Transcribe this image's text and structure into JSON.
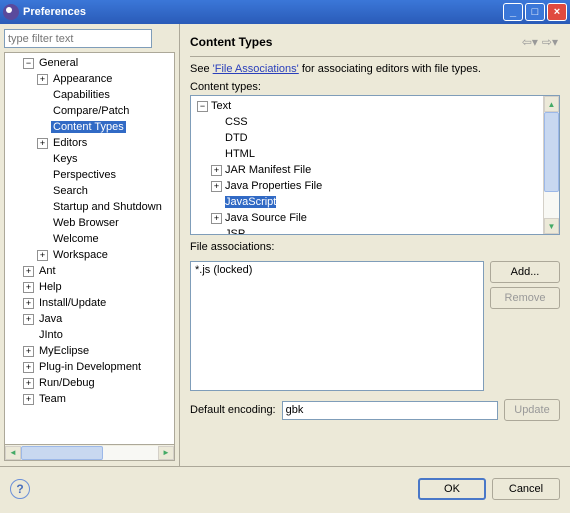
{
  "window": {
    "title": "Preferences"
  },
  "filter": {
    "placeholder": "type filter text"
  },
  "tree": {
    "general": "General",
    "general_children": {
      "appearance": "Appearance",
      "capabilities": "Capabilities",
      "compare_patch": "Compare/Patch",
      "content_types": "Content Types",
      "editors": "Editors",
      "keys": "Keys",
      "perspectives": "Perspectives",
      "search": "Search",
      "startup_shutdown": "Startup and Shutdown",
      "web_browser": "Web Browser",
      "welcome": "Welcome",
      "workspace": "Workspace"
    },
    "top": {
      "ant": "Ant",
      "help": "Help",
      "install_update": "Install/Update",
      "java": "Java",
      "jinto": "JInto",
      "myeclipse": "MyEclipse",
      "plugin_dev": "Plug-in Development",
      "run_debug": "Run/Debug",
      "team": "Team"
    }
  },
  "page": {
    "title": "Content Types",
    "see_prefix": "See ",
    "see_link": "'File Associations'",
    "see_suffix": " for associating editors with file types.",
    "content_types_label": "Content types:",
    "file_assoc_label": "File associations:",
    "add_button": "Add...",
    "remove_button": "Remove",
    "default_encoding_label": "Default encoding:",
    "encoding_value": "gbk",
    "update_button": "Update"
  },
  "content_types": {
    "text": "Text",
    "css": "CSS",
    "dtd": "DTD",
    "html": "HTML",
    "jar_manifest": "JAR Manifest File",
    "java_properties": "Java Properties File",
    "javascript": "JavaScript",
    "java_source": "Java Source File",
    "jsp": "JSP"
  },
  "file_assoc": {
    "items": [
      "*.js (locked)"
    ]
  },
  "footer": {
    "ok": "OK",
    "cancel": "Cancel"
  }
}
